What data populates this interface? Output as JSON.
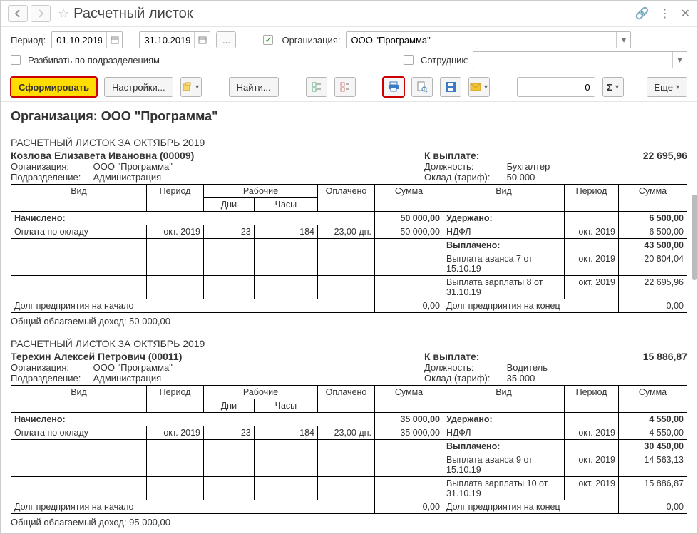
{
  "header": {
    "title": "Расчетный листок"
  },
  "filters": {
    "period_label": "Период:",
    "date_from": "01.10.2019",
    "date_to": "31.10.2019",
    "dash": "–",
    "split_label": "Разбивать по подразделениям",
    "org_label": "Организация:",
    "org_value": "ООО \"Программа\"",
    "emp_label": "Сотрудник:",
    "emp_value": ""
  },
  "toolbar": {
    "generate": "Сформировать",
    "settings": "Настройки...",
    "find": "Найти...",
    "num_value": "0",
    "more": "Еще"
  },
  "report": {
    "org_title": "Организация: ООО \"Программа\"",
    "slips": [
      {
        "title": "РАСЧЕТНЫЙ ЛИСТОК ЗА ОКТЯБРЬ 2019",
        "person": "Козлова Елизавета Ивановна (00009)",
        "org": "ООО \"Программа\"",
        "dept": "Администрация",
        "position": "Бухгалтер",
        "salary": "50 000",
        "to_pay": "22 695,96",
        "accrued_total": "50 000,00",
        "withheld_total": "6 500,00",
        "paid_total": "43 500,00",
        "accrued": [
          {
            "name": "Оплата по окладу",
            "period": "окт. 2019",
            "days": "23",
            "hours": "184",
            "paid": "23,00 дн.",
            "sum": "50 000,00"
          }
        ],
        "withheld": [
          {
            "name": "НДФЛ",
            "period": "окт. 2019",
            "sum": "6 500,00"
          }
        ],
        "paid": [
          {
            "name": "Выплата аванса 7 от 15.10.19",
            "period": "окт. 2019",
            "sum": "20 804,04"
          },
          {
            "name": "Выплата зарплаты 8 от 31.10.19",
            "period": "окт. 2019",
            "sum": "22 695,96"
          }
        ],
        "debt_start": "0,00",
        "debt_end": "0,00",
        "taxable": "50 000,00"
      },
      {
        "title": "РАСЧЕТНЫЙ ЛИСТОК ЗА ОКТЯБРЬ 2019",
        "person": "Терехин Алексей Петрович (00011)",
        "org": "ООО \"Программа\"",
        "dept": "Администрация",
        "position": "Водитель",
        "salary": "35 000",
        "to_pay": "15 886,87",
        "accrued_total": "35 000,00",
        "withheld_total": "4 550,00",
        "paid_total": "30 450,00",
        "accrued": [
          {
            "name": "Оплата по окладу",
            "period": "окт. 2019",
            "days": "23",
            "hours": "184",
            "paid": "23,00 дн.",
            "sum": "35 000,00"
          }
        ],
        "withheld": [
          {
            "name": "НДФЛ",
            "period": "окт. 2019",
            "sum": "4 550,00"
          }
        ],
        "paid": [
          {
            "name": "Выплата аванса 9 от 15.10.19",
            "period": "окт. 2019",
            "sum": "14 563,13"
          },
          {
            "name": "Выплата зарплаты 10 от 31.10.19",
            "period": "окт. 2019",
            "sum": "15 886,87"
          }
        ],
        "debt_start": "0,00",
        "debt_end": "0,00",
        "taxable": "95 000,00"
      }
    ]
  },
  "labels": {
    "vid": "Вид",
    "period": "Период",
    "work": "Рабочие",
    "days": "Дни",
    "hours": "Часы",
    "paid": "Оплачено",
    "sum": "Сумма",
    "accrued": "Начислено:",
    "withheld": "Удержано:",
    "paidout": "Выплачено:",
    "org": "Организация:",
    "dept": "Подразделение:",
    "position": "Должность:",
    "salary": "Оклад (тариф):",
    "to_pay": "К выплате:",
    "debt_start": "Долг предприятия на начало",
    "debt_end": "Долг предприятия на конец",
    "taxable": "Общий облагаемый доход:"
  }
}
